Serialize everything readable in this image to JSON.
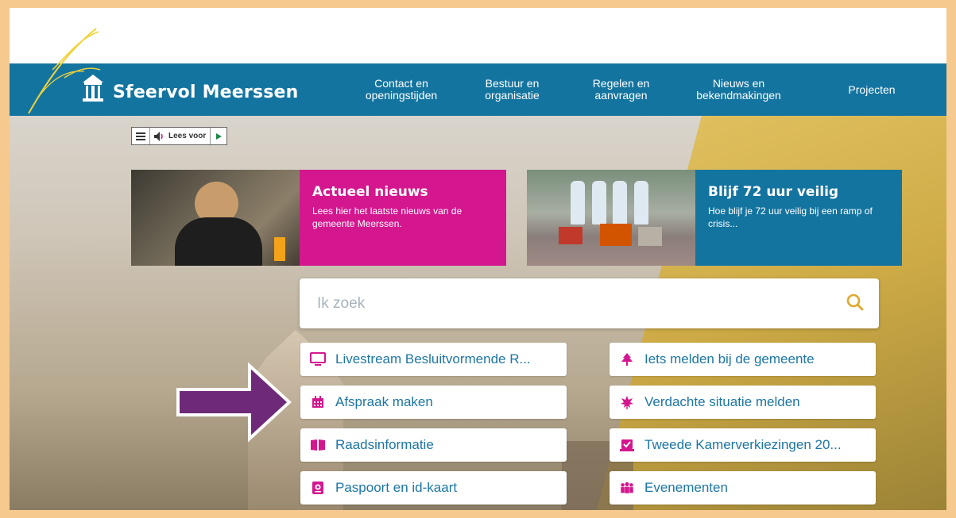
{
  "site": {
    "name": "Sfeervol Meerssen"
  },
  "nav": {
    "items": [
      {
        "line1": "Contact en",
        "line2": "openingstijden"
      },
      {
        "line1": "Bestuur en",
        "line2": "organisatie"
      },
      {
        "line1": "Regelen en",
        "line2": "aanvragen"
      },
      {
        "line1": "Nieuws en",
        "line2": "bekendmakingen"
      },
      {
        "line1": "Projecten",
        "line2": ""
      }
    ]
  },
  "readspeaker": {
    "label": "Lees voor"
  },
  "cards": [
    {
      "title": "Actueel nieuws",
      "text": "Lees hier het laatste nieuws van de gemeente Meerssen.",
      "color": "#d4178f"
    },
    {
      "title": "Blijf 72 uur veilig",
      "text": "Hoe blijf je 72 uur veilig bij een ramp of crisis...",
      "color": "#1474a0"
    }
  ],
  "search": {
    "placeholder": "Ik zoek"
  },
  "quicklinks": {
    "left": [
      {
        "label": "Livestream Besluitvormende R...",
        "icon": "monitor-icon"
      },
      {
        "label": "Afspraak maken",
        "icon": "calendar-icon"
      },
      {
        "label": "Raadsinformatie",
        "icon": "book-icon"
      },
      {
        "label": "Paspoort en id-kaart",
        "icon": "passport-icon"
      }
    ],
    "right": [
      {
        "label": "Iets melden bij de gemeente",
        "icon": "tree-icon"
      },
      {
        "label": "Verdachte situatie melden",
        "icon": "leaf-icon"
      },
      {
        "label": "Tweede Kamerverkiezingen 20...",
        "icon": "ballot-icon"
      },
      {
        "label": "Evenementen",
        "icon": "people-icon"
      }
    ]
  },
  "colors": {
    "accent": "#d4178f",
    "brand": "#1474a0",
    "search_icon": "#e0a82e",
    "arrow": "#6e2a78",
    "frame": "#f6c98e"
  }
}
